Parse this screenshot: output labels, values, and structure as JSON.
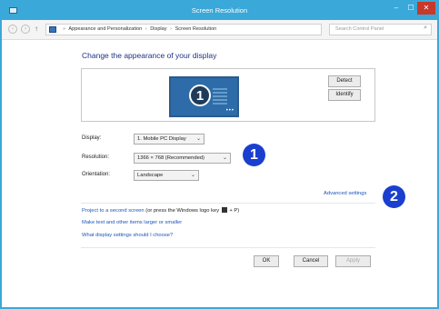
{
  "window": {
    "title": "Screen Resolution",
    "min": "–",
    "max": "☐",
    "close": "✕"
  },
  "address": {
    "breadcrumbs": [
      "Appearance and Personalization",
      "Display",
      "Screen Resolution"
    ],
    "search_placeholder": "Search Control Panel",
    "back": "‹",
    "forward": "›",
    "up": "↑",
    "refresh": "↻",
    "dropdown": "⌄",
    "search_icon": "⌕"
  },
  "main": {
    "heading": "Change the appearance of your display",
    "monitor_number": "1",
    "monitor_dots": "•••",
    "detect_label": "Detect",
    "identify_label": "Identify",
    "display": {
      "label": "Display:",
      "value": "1. Mobile PC Display"
    },
    "resolution": {
      "label": "Resolution:",
      "value": "1366 × 768 (Recommended)"
    },
    "orientation": {
      "label": "Orientation:",
      "value": "Landscape"
    },
    "advanced_link": "Advanced settings",
    "link_project": "Project to a second screen",
    "link_project_suffix_a": "(or press the Windows logo key",
    "link_project_suffix_b": "+ P)",
    "link_text_size": "Make text and other items larger or smaller",
    "link_which_settings": "What display settings should I choose?"
  },
  "callouts": [
    "1",
    "2"
  ],
  "buttons": {
    "ok": "OK",
    "cancel": "Cancel",
    "apply": "Apply"
  },
  "colors": {
    "titlebar": "#3aa8d8",
    "link": "#1a56b8",
    "heading": "#1e3287",
    "callout": "#1a3fcf"
  },
  "icons": [
    "control-panel-icon",
    "search-icon",
    "windows-logo-icon"
  ]
}
